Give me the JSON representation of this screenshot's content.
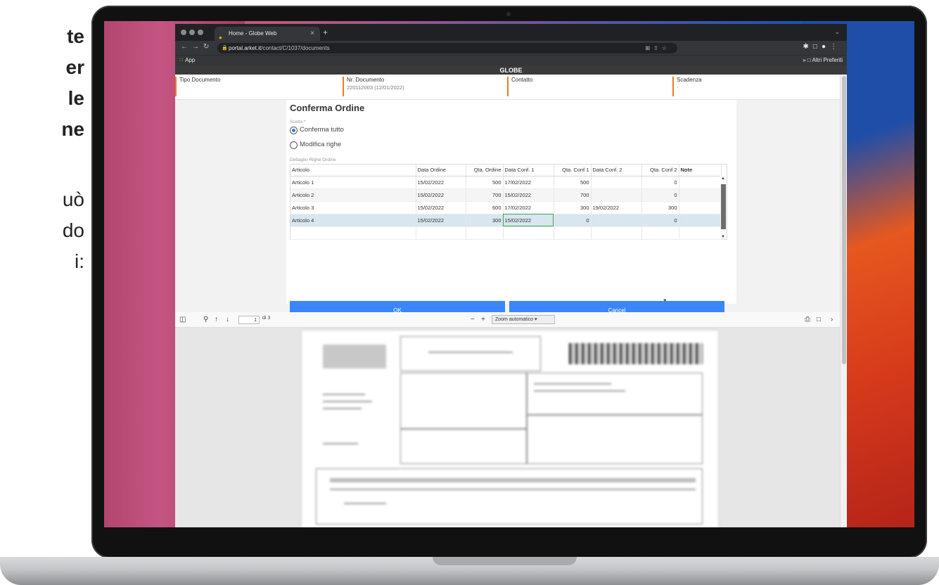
{
  "side_text": {
    "lines": [
      "te",
      "er",
      "le",
      "ne"
    ],
    "lines2": [
      "uò",
      "do",
      "i:"
    ]
  },
  "browser": {
    "tab_title": "Home - Globe Web",
    "url_host": "portal.arket.it",
    "url_path": "/contact/C/1037/documents",
    "apps_label": "App",
    "bookmarks_label": "Altri Preferiti"
  },
  "app": {
    "title": "GLOBE",
    "header": [
      {
        "label": "Tipo Documento",
        "value": ""
      },
      {
        "label": "Nr. Documento",
        "value": "220112003 (12/01/2022)"
      },
      {
        "label": "Contatto",
        "value": ""
      },
      {
        "label": "Scadenza",
        "value": "-"
      }
    ]
  },
  "modal": {
    "title": "Conferma Ordine",
    "choice_label": "Scelta *",
    "options": [
      "Conferma tutto",
      "Modifica righe"
    ],
    "selected": "Conferma tutto",
    "detail_label": "Dettaglio Righe Ordine",
    "columns": [
      "Articolo",
      "Data Ordine",
      "Qta. Ordine",
      "Data Conf. 1",
      "Qta. Conf 1",
      "Data Conf. 2",
      "Qta. Conf 2",
      "Note"
    ],
    "rows": [
      [
        "Articolo 1",
        "15/02/2022",
        "500",
        "17/02/2022",
        "500",
        "",
        "0",
        ""
      ],
      [
        "Articolo 2",
        "15/02/2022",
        "700",
        "15/02/2022",
        "700",
        "",
        "0",
        ""
      ],
      [
        "Articolo 3",
        "15/02/2022",
        "600",
        "17/02/2022",
        "300",
        "19/02/2022",
        "300",
        ""
      ],
      [
        "Articolo 4",
        "15/02/2022",
        "300",
        "15/02/2022",
        "0",
        "",
        "0",
        ""
      ]
    ],
    "ok_label": "OK",
    "cancel_label": "Cancel"
  },
  "pdf": {
    "page": "1",
    "of": "di 3",
    "zoom": "Zoom automatico"
  }
}
